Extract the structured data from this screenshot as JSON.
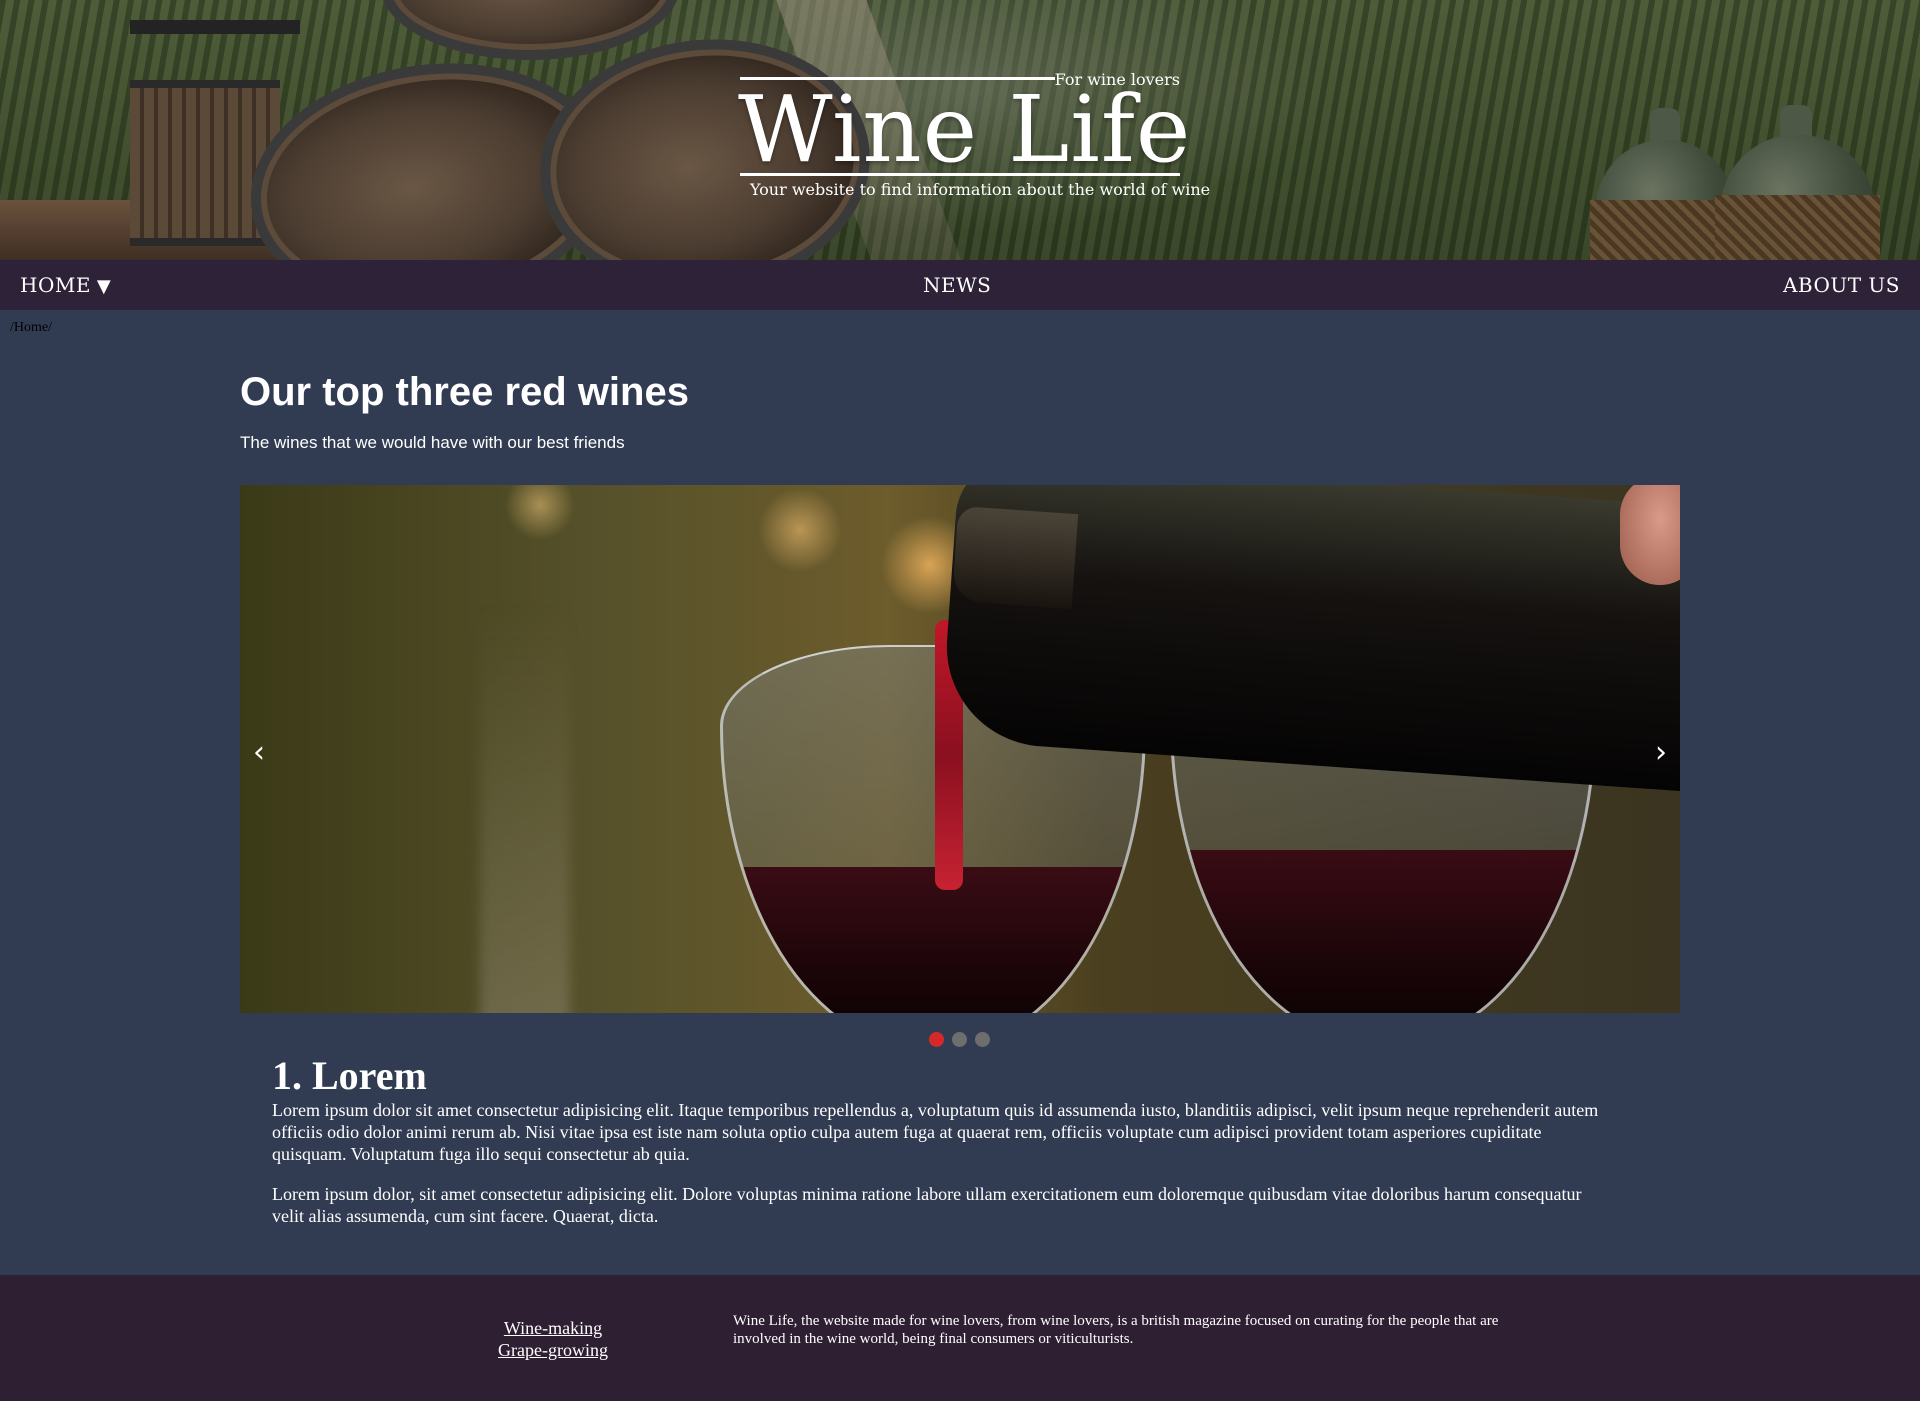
{
  "header": {
    "tagline": "For wine lovers",
    "title": "Wine Life",
    "subtitle": "Your website to find information about the world of wine"
  },
  "nav": {
    "home": "HOME",
    "news": "NEWS",
    "about": "ABOUT US"
  },
  "breadcrumb": "/Home/",
  "main": {
    "heading": "Our top three red wines",
    "subheading": "The wines that we would have with our best friends"
  },
  "carousel": {
    "prev": "‹",
    "next": "›",
    "slide_count": 3,
    "active_slide": 1
  },
  "article": {
    "title": "1. Lorem",
    "paragraphs": [
      "Lorem ipsum dolor sit amet consectetur adipisicing elit. Itaque temporibus repellendus a, voluptatum quis id assumenda iusto, blanditiis adipisci, velit ipsum neque reprehenderit autem officiis odio dolor animi rerum ab. Nisi vitae ipsa est iste nam soluta optio culpa autem fuga at quaerat rem, officiis voluptate cum adipisci provident totam asperiores cupiditate quisquam. Voluptatum fuga illo sequi consectetur ab quia.",
      "Lorem ipsum dolor, sit amet consectetur adipisicing elit. Dolore voluptas minima ratione labore ullam exercitationem eum doloremque quibusdam vitae doloribus harum consequatur velit alias assumenda, cum sint facere. Quaerat, dicta."
    ]
  },
  "footer": {
    "links": [
      "Wine-making",
      "Grape-growing"
    ],
    "about": "Wine Life, the website made for wine lovers, from wine lovers, is a british magazine focused on curating for the people that are involved in the wine world, being final consumers or viticulturists."
  },
  "colors": {
    "page_bg": "#313b52",
    "nav_bg": "#2e2238",
    "footer_bg": "#2e1f33",
    "active_dot": "#d62a2a",
    "inactive_dot": "#6e6e6e"
  }
}
